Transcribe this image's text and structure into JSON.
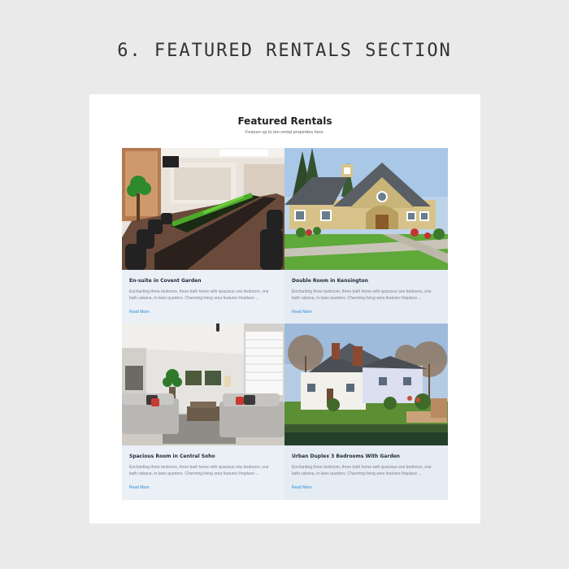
{
  "page": {
    "heading": "6. FEATURED RENTALS SECTION"
  },
  "section": {
    "title": "Featured Rentals",
    "subtitle": "Feature up to ten rental properties here."
  },
  "cards": [
    {
      "title": "En-suite in Covent Garden",
      "description": "Enchanting three bedroom, three bath home with spacious one bedroom, one bath cabana, in-laws quarters. Charming living area features fireplace ...",
      "link": "Read More"
    },
    {
      "title": "Double Room in Kensington",
      "description": "Enchanting three bedroom, three bath home with spacious one bedroom, one bath cabana, in-laws quarters. Charming living area features fireplace ...",
      "link": "Read More"
    },
    {
      "title": "Spacious Room in Central Soho",
      "description": "Enchanting three bedroom, three bath home with spacious one bedroom, one bath cabana, in-laws quarters. Charming living area features fireplace ...",
      "link": "Read More"
    },
    {
      "title": "Urban Duplex 3 Bedrooms With Garden",
      "description": "Enchanting three bedroom, three bath home with spacious one bedroom, one bath cabana, in-laws quarters. Charming living area features fireplace ...",
      "link": "Read More"
    }
  ],
  "colors": {
    "link": "#2a8cd8",
    "card_bg": "#eaf0f6",
    "panel_bg": "#ffffff",
    "page_bg": "#eaeaea"
  }
}
